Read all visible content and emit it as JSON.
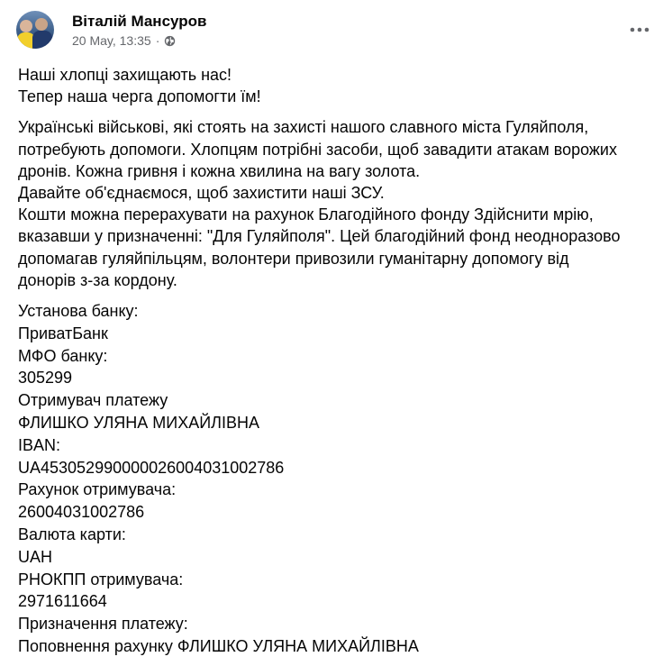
{
  "post": {
    "author": "Віталій Мансуров",
    "timestamp": "20 May, 13:35",
    "separator": "·",
    "privacy_icon": "globe-icon",
    "more_icon": "more-options-icon",
    "paragraphs": [
      {
        "lines": [
          "Наші хлопці захищають нас!",
          "Тепер наша черга допомогти їм!"
        ]
      },
      {
        "lines": [
          "Українські військові, які стоять на захисті нашого славного міста Гуляйполя,",
          "потребують допомоги. Хлопцям потрібні засоби, щоб завадити атакам ворожих",
          "дронів. Кожна гривня і кожна хвилина на вагу золота.",
          "Давайте об'єднаємося, щоб захистити наші ЗСУ.",
          "Кошти можна перерахувати на рахунок Благодійного фонду Здійснити мрію,",
          "вказавши у призначенні: \"Для Гуляйполя\". Цей благодійний фонд неодноразово",
          "допомагав гуляйпільцям, волонтери привозили гуманітарну допомогу від",
          "донорів з-за кордону."
        ]
      }
    ],
    "bank_details": [
      "Установа банку:",
      "ПриватБанк",
      "МФО банку:",
      "305299",
      "Отримувач платежу",
      "ФЛИШКО УЛЯНА МИХАЙЛІВНА",
      "IBAN:",
      "UA453052990000026004031002786",
      "Рахунок отримувача:",
      "26004031002786",
      "Валюта карти:",
      "UAH",
      "РНОКПП отримувача:",
      "2971611664",
      "Призначення платежу:",
      "Поповнення рахунку ФЛИШКО УЛЯНА МИХАЙЛІВНА"
    ]
  },
  "colors": {
    "text_primary": "#050505",
    "text_secondary": "#65676b",
    "background": "#ffffff"
  }
}
